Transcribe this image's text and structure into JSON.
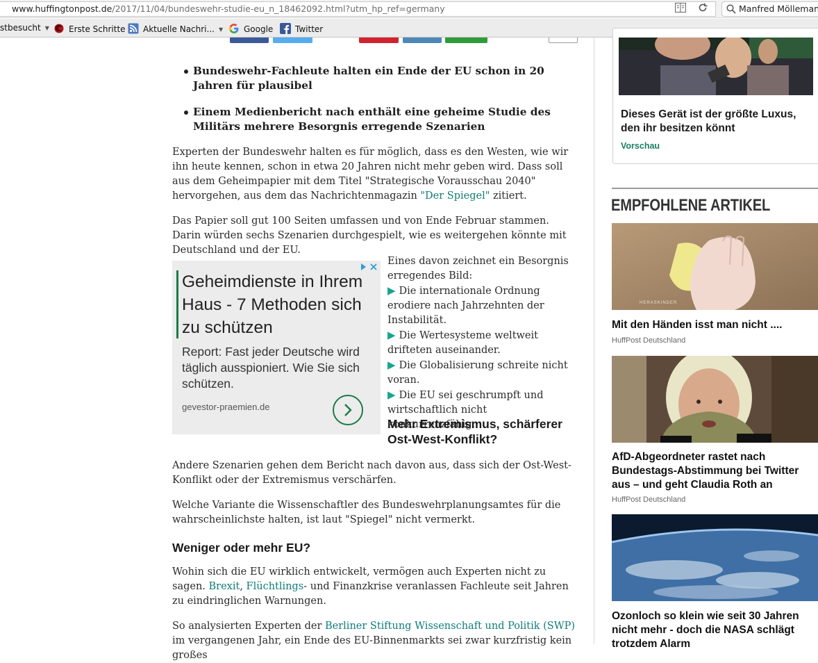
{
  "browser": {
    "url_host": "www.huffingtonpost.de",
    "url_path": "/2017/11/04/bundeswehr-studie-eu_n_18462092.html?utm_hp_ref=germany",
    "search_value": "Manfred Möllemann",
    "bookmarks": [
      {
        "label": "stbesucht",
        "icon": "none",
        "dropdown": true
      },
      {
        "label": "Erste Schritte",
        "icon": "firefox-icon",
        "dropdown": false
      },
      {
        "label": "Aktuelle Nachri...",
        "icon": "rss-icon",
        "dropdown": true
      },
      {
        "label": "Google",
        "icon": "google-icon",
        "dropdown": false
      },
      {
        "label": "Twitter",
        "icon": "facebook-icon",
        "dropdown": false
      }
    ]
  },
  "article": {
    "bullets": [
      "Bundeswehr-Fachleute halten ein Ende der EU schon in 20 Jahren für plausibel",
      "Einem Medienbericht nach enthält eine geheime Studie des Militärs mehrere Besorgnis erregende Szenarien"
    ],
    "p1_text": "Experten der Bundeswehr halten es für möglich, dass es den Westen, wie wir ihn heute kennen, schon in etwa 20 Jahren nicht mehr geben wird. Dass soll aus dem Geheimpapier mit dem Titel \"Strategische Vorausschau 2040\" hervorgehen, aus dem das Nachrichtenmagazin ",
    "p1_link": "\"Der Spiegel\"",
    "p1_tail": " zitiert.",
    "p2": "Das Papier soll gut 100 Seiten umfassen und von Ende Februar stammen. Darin würden sechs Szenarien durchgespielt, wie es weitergehen könnte mit Deutschland und der EU.",
    "scenario_intro": "Eines davon zeichnet ein Besorgnis erregendes Bild:",
    "scenarios": [
      "Die internationale Ordnung erodiere nach Jahrzehnten der Instabilität.",
      "Die Wertesysteme weltweit drifteten auseinander.",
      "Die Globalisierung schreite nicht voran.",
      "Die EU sei geschrumpft und wirtschaftlich nicht konkurrenzfähig."
    ],
    "subheading1": "Mehr Extremismus, schärferer Ost-West-Konflikt?",
    "p3": "Andere Szenarien gehen dem Bericht nach davon aus, dass sich der Ost-West-Konflikt oder der Extremismus verschärfen.",
    "p4": "Welche Variante die Wissenschaftler des Bundeswehrplanungsamtes für die wahrscheinlichste halten, ist laut \"Spiegel\" nicht vermerkt.",
    "subheading2": "Weniger oder mehr EU?",
    "p5_text": "Wohin sich die EU wirklich entwickelt, vermögen auch Experten nicht zu sagen. ",
    "p5_link1": "Brexit",
    "p5_comma": ", ",
    "p5_link2": "Flüchtlings",
    "p5_tail": "- und Finanzkrise veranlassen Fachleute seit Jahren zu eindringlichen Warnungen.",
    "p6_text": "So analysierten Experten der ",
    "p6_link": "Berliner Stiftung Wissenschaft und Politik (SWP)",
    "p6_tail": " im vergangenen Jahr, ein Ende des EU-Binnenmarkts sei zwar kurzfristig kein großes"
  },
  "ad": {
    "headline": "Geheimdienste in Ihrem Haus - 7 Methoden sich zu schützen",
    "body": "Report: Fast jeder Deutsche wird täglich ausspioniert. Wie Sie sich schützen.",
    "domain": "gevestor-praemien.de"
  },
  "sidebar": {
    "promo_title": "Dieses Gerät ist der größte Luxus, den ihr besitzen könnt",
    "promo_link": "Vorschau",
    "heading": "EMPFOHLENE ARTIKEL",
    "cards": [
      {
        "title": "Mit den Händen isst man nicht ....",
        "source": "HuffPost Deutschland",
        "watermark": "HERASKINDER"
      },
      {
        "title": "AfD-Abgeordneter rastet nach Bundestags-Abstimmung bei Twitter aus – und geht Claudia Roth an",
        "source": "HuffPost Deutschland"
      },
      {
        "title": "Ozonloch so klein wie seit 30 Jahren nicht mehr - doch die NASA schlägt trotzdem Alarm",
        "source": ""
      }
    ]
  },
  "colors": {
    "link": "#0f7d78",
    "triangle": "#18a58c",
    "ad_green": "#1a7a45"
  }
}
